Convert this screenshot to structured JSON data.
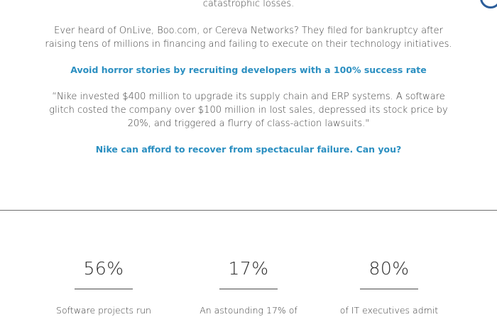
{
  "article": {
    "intro_tail": "catastrophic losses.",
    "history_paragraph": "Ever heard of OnLive, Boo.com, or Cereva Networks? They filed for bankruptcy after raising tens of millions in financing and failing to execute on their technology initiatives.",
    "recruit_callout": "Avoid horror stories by recruiting developers with a 100% success rate",
    "nike_quote": "“Nike invested $400 million to upgrade its supply chain and ERP systems. A software glitch costed the company over $100 million in lost sales, depressed its stock price by 20%, and triggered a flurry of class-action lawsuits.\"",
    "nike_callout": "Nike can afford to recover from spectacular failure. Can you?"
  },
  "stats": [
    {
      "value": "56%",
      "caption": "Software projects run"
    },
    {
      "value": "17%",
      "caption": "An astounding 17% of"
    },
    {
      "value": "80%",
      "caption": "of IT executives admit"
    }
  ],
  "colors": {
    "accent": "#2b8fc1",
    "text": "#3d3d3d",
    "corner_ring": "#2b5d9a"
  }
}
